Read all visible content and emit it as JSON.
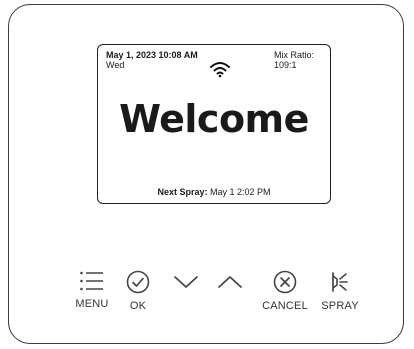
{
  "screen": {
    "datetime": "May 1, 2023 10:08 AM",
    "day": "Wed",
    "mix_ratio_label": "Mix Ratio:",
    "mix_ratio_value": "109:1",
    "message": "Welcome",
    "next_spray_label": "Next Spray:",
    "next_spray_value": "May 1 2:02 PM"
  },
  "buttons": {
    "menu": "MENU",
    "ok": "OK",
    "cancel": "CANCEL",
    "spray": "SPRAY"
  },
  "icons": {
    "wifi": "wifi-icon",
    "menu": "menu-icon",
    "ok": "check-circle-icon",
    "down": "chevron-down-icon",
    "up": "chevron-up-icon",
    "cancel": "x-circle-icon",
    "spray": "spray-icon"
  }
}
